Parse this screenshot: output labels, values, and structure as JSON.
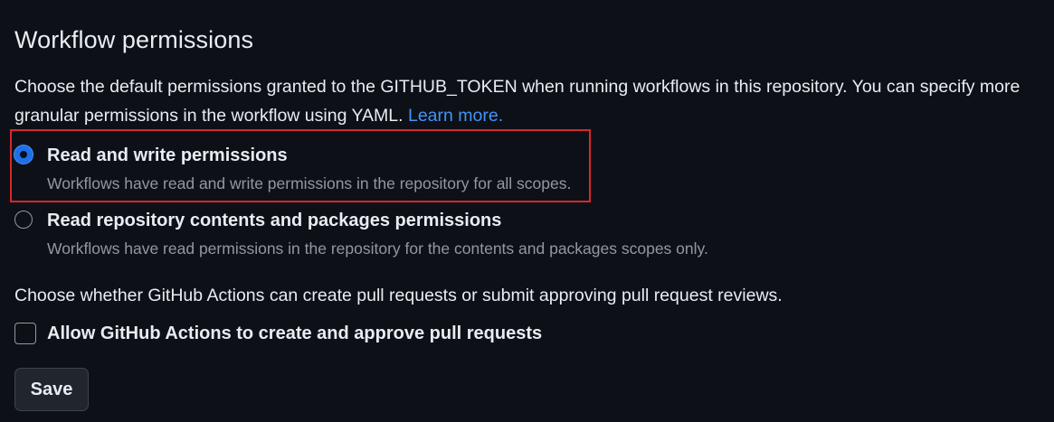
{
  "workflow_permissions": {
    "title": "Workflow permissions",
    "description": "Choose the default permissions granted to the GITHUB_TOKEN when running workflows in this repository. You can specify more granular permissions in the workflow using YAML.",
    "learn_more": "Learn more.",
    "options": [
      {
        "label": "Read and write permissions",
        "hint": "Workflows have read and write permissions in the repository for all scopes.",
        "checked": true
      },
      {
        "label": "Read repository contents and packages permissions",
        "hint": "Workflows have read permissions in the repository for the contents and packages scopes only.",
        "checked": false
      }
    ]
  },
  "pull_requests": {
    "description": "Choose whether GitHub Actions can create pull requests or submit approving pull request reviews.",
    "checkbox_label": "Allow GitHub Actions to create and approve pull requests",
    "checked": false
  },
  "save_label": "Save",
  "colors": {
    "background": "#0d1117",
    "text": "#e6edf3",
    "muted": "#9198a1",
    "accent": "#4493f8",
    "highlight": "#d9262d"
  }
}
